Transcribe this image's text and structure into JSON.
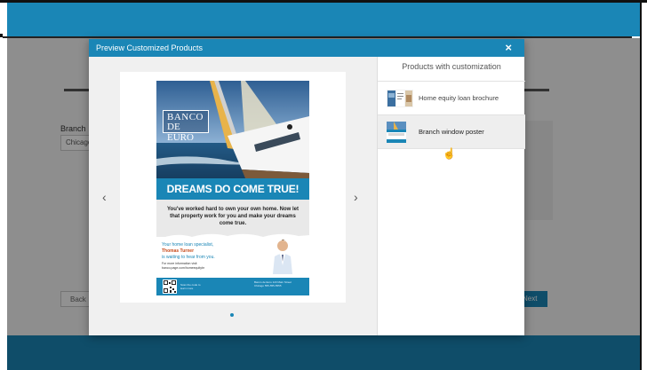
{
  "background": {
    "branch_label": "Branch",
    "branch_value": "Chicago",
    "back_label": "Back",
    "next_label": "Next"
  },
  "modal": {
    "title": "Preview Customized Products",
    "close_symbol": "×",
    "prev_symbol": "‹",
    "next_symbol": "›"
  },
  "poster": {
    "brand_line1": "BANCO",
    "brand_line2": "DE EURO",
    "headline": "DREAMS DO COME TRUE!",
    "body": "You've worked hard to own your own home. Now let that property work for you and make your dreams come true.",
    "specialist_line1": "Your home loan specialist,",
    "specialist_name": "Thomas Turner",
    "specialist_line3": "is waiting to hear from you.",
    "more_info": "For more information visit",
    "url": "banco.page.com/homeequitybr",
    "qr_caption": "Scan the code to learn more",
    "address": "Banco de Euro 123 Main Street Chicago 555-555-5555"
  },
  "products": {
    "title": "Products with customization",
    "items": [
      {
        "label": "Home equity loan brochure",
        "selected": false
      },
      {
        "label": "Branch window poster",
        "selected": true
      }
    ]
  },
  "colors": {
    "brand_blue": "#1a86b6",
    "accent_name": "#c74a1a"
  }
}
